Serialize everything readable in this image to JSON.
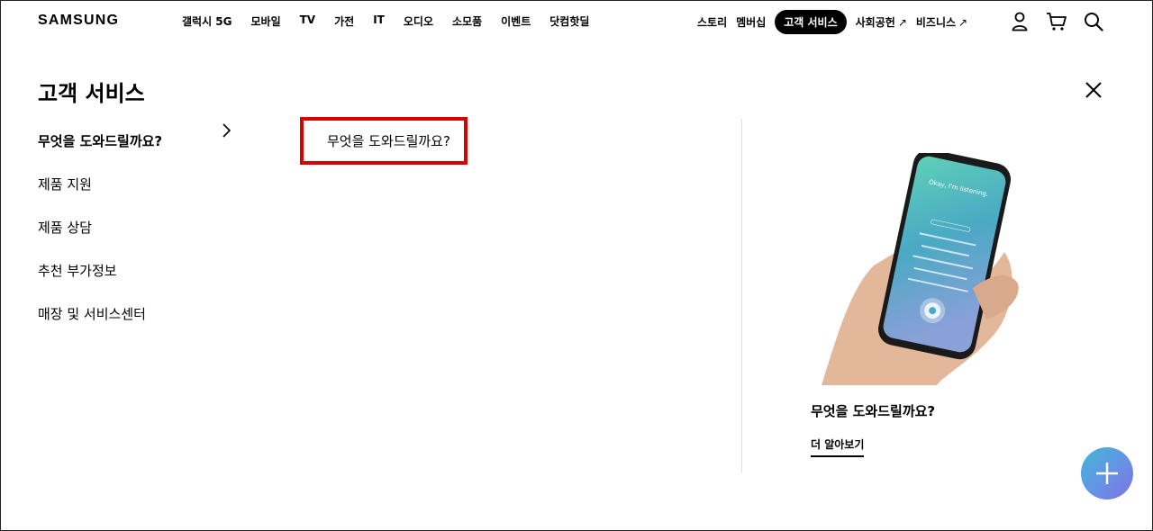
{
  "header": {
    "logo": "SAMSUNG",
    "nav_left": [
      "갤럭시 5G",
      "모바일",
      "TV",
      "가전",
      "IT",
      "오디오",
      "소모품",
      "이벤트",
      "닷컴핫딜"
    ],
    "nav_right": {
      "story": "스토리",
      "membership": "멤버십",
      "customer_service": "고객 서비스",
      "social": "사회공헌",
      "business": "비즈니스",
      "external_arrow": "↗"
    },
    "icons": [
      "user-icon",
      "cart-icon",
      "search-icon"
    ]
  },
  "menu": {
    "title": "고객 서비스",
    "items": [
      {
        "label": "무엇을 도와드릴까요?"
      },
      {
        "label": "제품 지원"
      },
      {
        "label": "제품 상담"
      },
      {
        "label": "추천 부가정보"
      },
      {
        "label": "매장 및 서비스센터"
      }
    ],
    "sub_item": "무엇을 도와드릴까요?"
  },
  "promo": {
    "title": "무엇을 도와드릴까요?",
    "link": "더 알아보기",
    "phone_text": "Okay, I'm listening."
  },
  "colors": {
    "highlight": "#d80000",
    "fab_start": "#3fb8d8",
    "fab_end": "#7c72e0"
  }
}
